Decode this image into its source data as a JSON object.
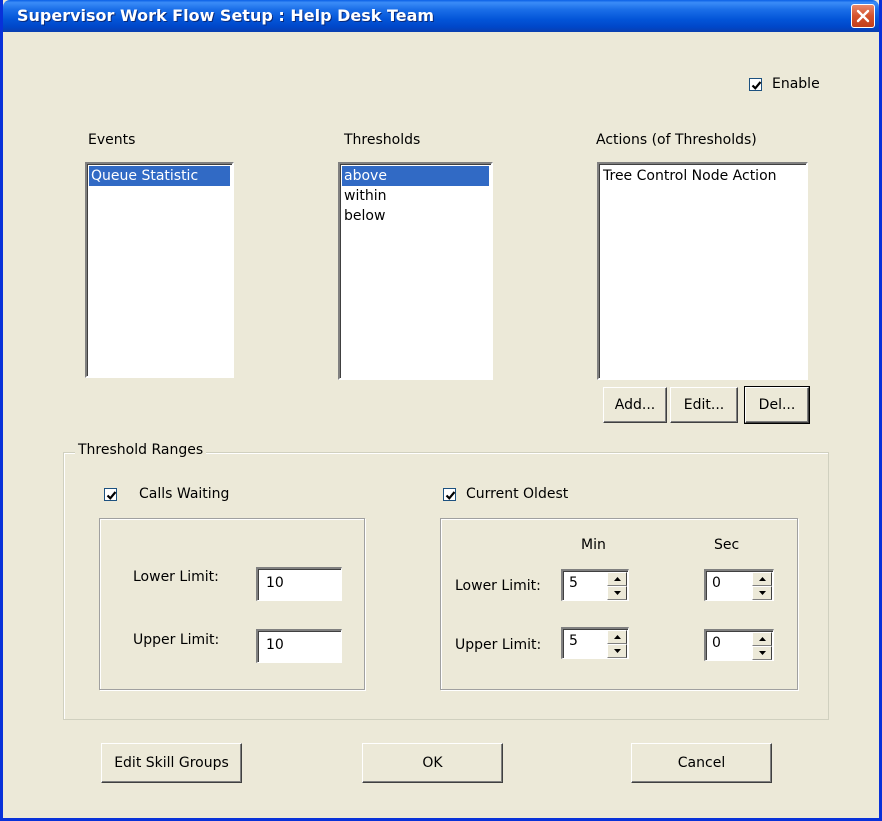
{
  "window": {
    "title": "Supervisor Work Flow Setup :  Help Desk Team"
  },
  "enable": {
    "label": "Enable",
    "checked": true
  },
  "events": {
    "header": "Events",
    "items": [
      {
        "label": "Queue Statistic",
        "selected": true
      }
    ]
  },
  "thresholds": {
    "header": "Thresholds",
    "items": [
      {
        "label": "above",
        "selected": true
      },
      {
        "label": "within",
        "selected": false
      },
      {
        "label": "below",
        "selected": false
      }
    ]
  },
  "actions": {
    "header": "Actions (of Thresholds)",
    "items": [
      {
        "label": "Tree Control Node Action",
        "selected": false
      }
    ],
    "add_label": "Add...",
    "edit_label": "Edit...",
    "del_label": "Del..."
  },
  "threshold_ranges": {
    "title": "Threshold Ranges",
    "calls_waiting": {
      "label": "Calls Waiting",
      "checked": true,
      "lower_label": "Lower Limit:",
      "lower_value": "10",
      "upper_label": "Upper Limit:",
      "upper_value": "10"
    },
    "current_oldest": {
      "label": "Current Oldest",
      "checked": true,
      "min_header": "Min",
      "sec_header": "Sec",
      "lower_label": "Lower Limit:",
      "lower_min": "5",
      "lower_sec": "0",
      "upper_label": "Upper Limit:",
      "upper_min": "5",
      "upper_sec": "0"
    }
  },
  "footer": {
    "edit_skill_groups_label": "Edit Skill Groups",
    "ok_label": "OK",
    "cancel_label": "Cancel"
  }
}
